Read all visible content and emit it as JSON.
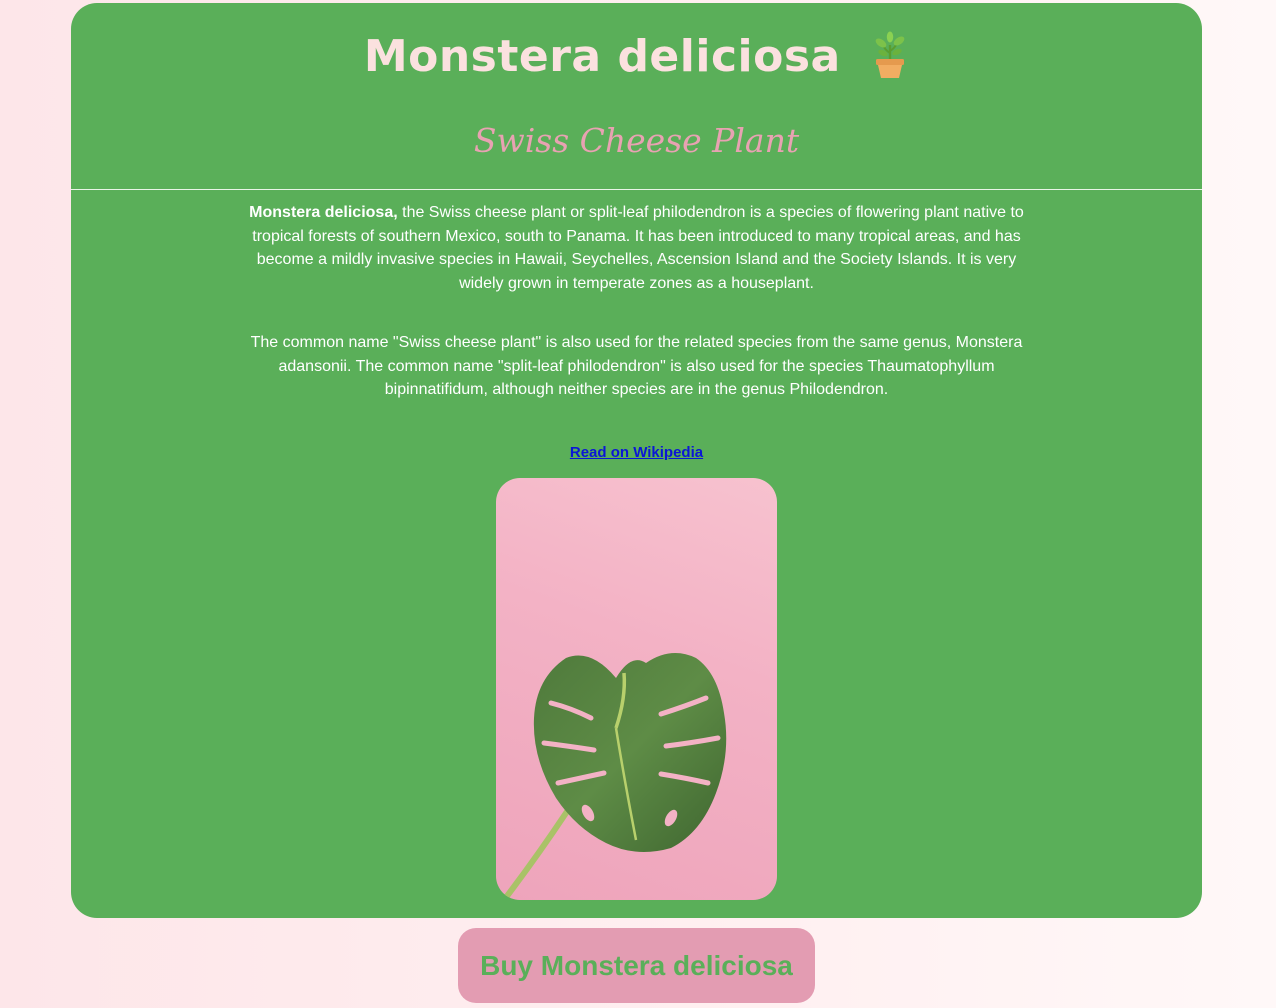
{
  "title": "Monstera deliciosa",
  "icon": "potted-plant-icon",
  "subtitle": "Swiss Cheese Plant",
  "description": {
    "bold_name": "Monstera deliciosa,",
    "paragraph1_rest": " the Swiss cheese plant or split-leaf philodendron is a species of flowering plant native to tropical forests of southern Mexico, south to Panama. It has been introduced to many tropical areas, and has become a mildly invasive species in Hawaii, Seychelles, Ascension Island and the Society Islands. It is very widely grown in temperate zones as a houseplant.",
    "paragraph2": "The common name \"Swiss cheese plant\" is also used for the related species from the same genus, Monstera adansonii. The common name \"split-leaf philodendron\" is also used for the species Thaumatophyllum bipinnatifidum, although neither species are in the genus Philodendron."
  },
  "link": {
    "label": "Read on Wikipedia"
  },
  "image": {
    "subject": "monstera-leaf-photo"
  },
  "buy_button": {
    "label": "Buy Monstera deliciosa"
  },
  "colors": {
    "card_background": "#5aaf59",
    "title_color": "#fbe1df",
    "subtitle_color": "#e8a2b2",
    "button_background": "#e39cb2",
    "button_text": "#5aaf59",
    "link_color": "#0b16d6",
    "page_background": "#fde6e9"
  }
}
